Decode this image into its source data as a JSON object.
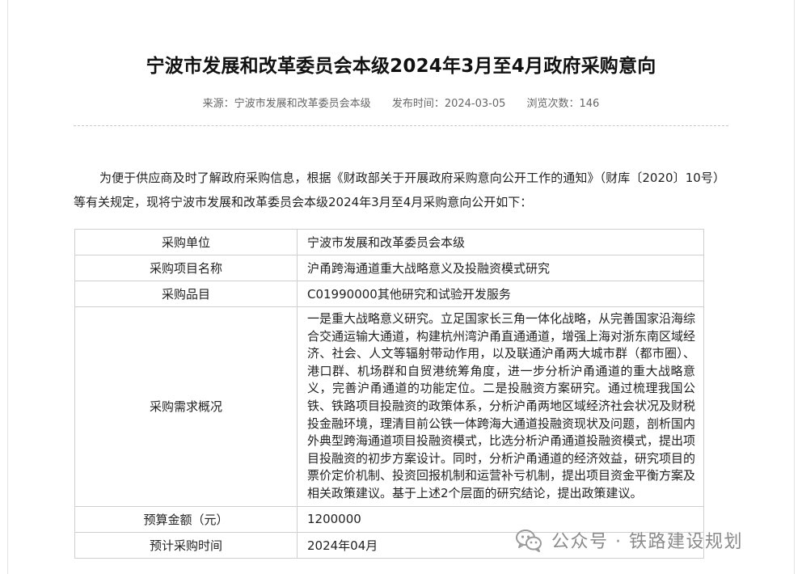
{
  "article": {
    "title": "宁波市发展和改革委员会本级2024年3月至4月政府采购意向",
    "meta": {
      "source": "来源：宁波市发展和改革委员会本级",
      "published": "发布时间：2024-03-05",
      "views": "浏览次数：146"
    },
    "intro": "为便于供应商及时了解政府采购信息，根据《财政部关于开展政府采购意向公开工作的通知》（财库〔2020〕10号）等有关规定，现将宁波市发展和改革委员会本级2024年3月至4月采购意向公开如下："
  },
  "table": {
    "rows": [
      {
        "key": "采购单位",
        "value": "宁波市发展和改革委员会本级"
      },
      {
        "key": "采购项目名称",
        "value": "沪甬跨海通道重大战略意义及投融资模式研究"
      },
      {
        "key": "采购品目",
        "value": "C01990000其他研究和试验开发服务"
      },
      {
        "key": "采购需求概况",
        "value": "一是重大战略意义研究。立足国家长三角一体化战略，从完善国家沿海综合交通运输大通道，构建杭州湾沪甬直通通道，增强上海对浙东南区域经济、社会、人文等辐射带动作用，以及联通沪甬两大城市群（都市圈）、港口群、机场群和自贸港统筹角度，进一步分析沪甬通道的重大战略意义，完善沪甬通道的功能定位。二是投融资方案研究。通过梳理我国公铁、铁路项目投融资的政策体系，分析沪甬两地区域经济社会状况及财税投金融环境，理清目前公铁一体跨海大通道投融资现状及问题，剖析国内外典型跨海通道项目投融资模式，比选分析沪甬通道投融资模式，提出项目投融资的初步方案设计。同时，分析沪甬通道的经济效益，研究项目的票价定价机制、投资回报机制和运营补亏机制，提出项目资金平衡方案及相关政策建议。基于上述2个层面的研究结论，提出政策建议。"
      },
      {
        "key": "预算金额（元）",
        "value": "1200000"
      },
      {
        "key": "预计采购时间",
        "value": "2024年04月"
      }
    ]
  },
  "watermark": {
    "text": "公众号 · 铁路建设规划",
    "icon": "wechat-icon"
  }
}
